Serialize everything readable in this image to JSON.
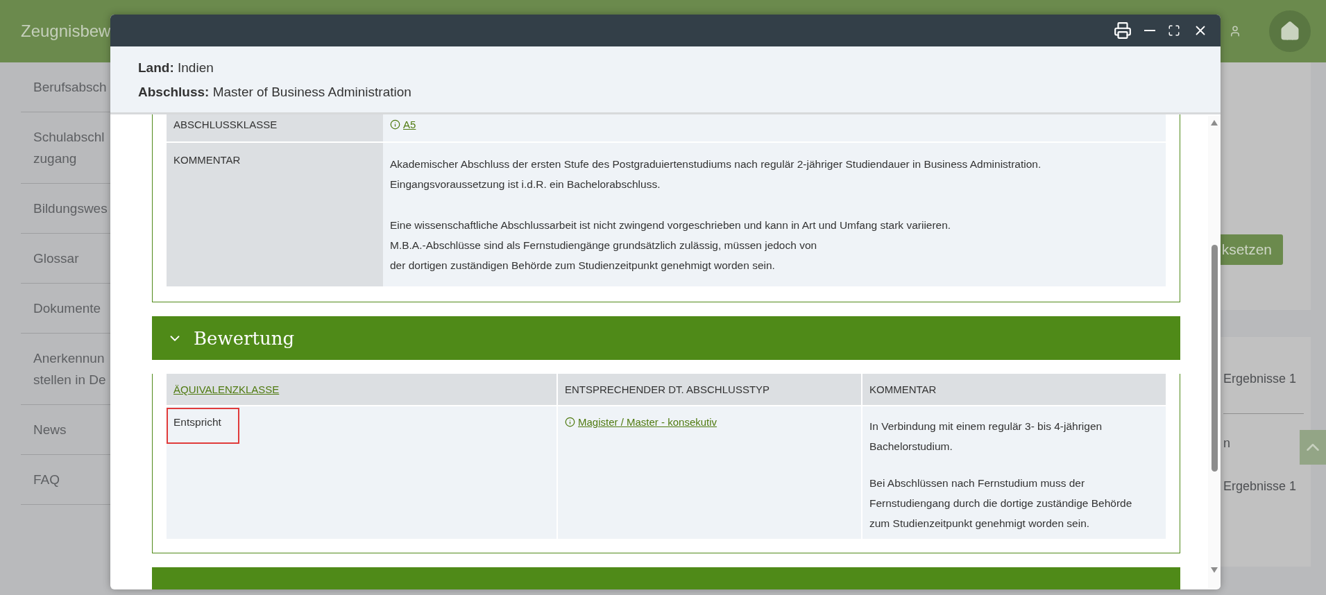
{
  "app_header": {
    "title": "Zeugnisbew"
  },
  "sidebar": {
    "items": [
      {
        "lines": [
          "Berufsabsch"
        ]
      },
      {
        "lines": [
          "Schulabschl",
          "zugang"
        ]
      },
      {
        "lines": [
          "Bildungswes"
        ]
      },
      {
        "lines": [
          "Glossar"
        ]
      },
      {
        "lines": [
          "Dokumente"
        ]
      },
      {
        "lines": [
          "Anerkennun",
          "stellen in De"
        ]
      },
      {
        "lines": [
          "News"
        ]
      },
      {
        "lines": [
          "FAQ"
        ]
      }
    ]
  },
  "background_panel": {
    "reset_button": "ksetzen",
    "results": [
      {
        "text": "Ergebnisse 1",
        "divider_after": true
      },
      {
        "text": "n",
        "divider_after": false
      },
      {
        "text": "Ergebnisse 1",
        "divider_after": false
      }
    ]
  },
  "dialog": {
    "info": [
      {
        "label": "Land:",
        "value": "Indien"
      },
      {
        "label": "Abschluss:",
        "value": "Master of Business Administration"
      }
    ],
    "sections": [
      {
        "kind": "details",
        "rows": [
          {
            "label": "ABSCHLUSSKLASSE",
            "link": "A5"
          },
          {
            "label": "KOMMENTAR",
            "paragraphs": [
              [
                "Akademischer Abschluss der ersten Stufe des Postgraduiertenstudiums nach regulär 2-jähriger Studiendauer in Business Administration.",
                "Eingangsvoraussetzung ist i.d.R. ein Bachelorabschluss."
              ],
              [
                "Eine wissenschaftliche Abschlussarbeit ist nicht zwingend vorgeschrieben und kann in Art und Umfang stark variieren.",
                "M.B.A.-Abschlüsse sind als Fernstudiengänge grundsätzlich zulässig, müssen jedoch von",
                "der dortigen zuständigen Behörde zum Studienzeitpunkt genehmigt worden sein."
              ]
            ]
          }
        ]
      },
      {
        "kind": "table",
        "title": "Bewertung",
        "expanded": true,
        "columns": [
          {
            "label": "ÄQUIVALENZKLASSE",
            "link": true
          },
          {
            "label": "ENTSPRECHENDER DT. ABSCHLUSSTYP",
            "link": false
          },
          {
            "label": "KOMMENTAR",
            "link": false
          }
        ],
        "rows": [
          {
            "equivalence": "Entspricht",
            "highlighted": true,
            "degree_link": "Magister / Master - konsekutiv",
            "paragraphs": [
              [
                "In Verbindung mit einem regulär 3- bis 4-jährigen",
                "Bachelorstudium."
              ],
              [
                "Bei Abschlüssen nach Fernstudium muss der",
                "Fernstudiengang durch die dortige zuständige Behörde",
                "zum Studienzeitpunkt genehmigt worden sein."
              ]
            ]
          }
        ]
      },
      {
        "kind": "cut"
      }
    ]
  }
}
